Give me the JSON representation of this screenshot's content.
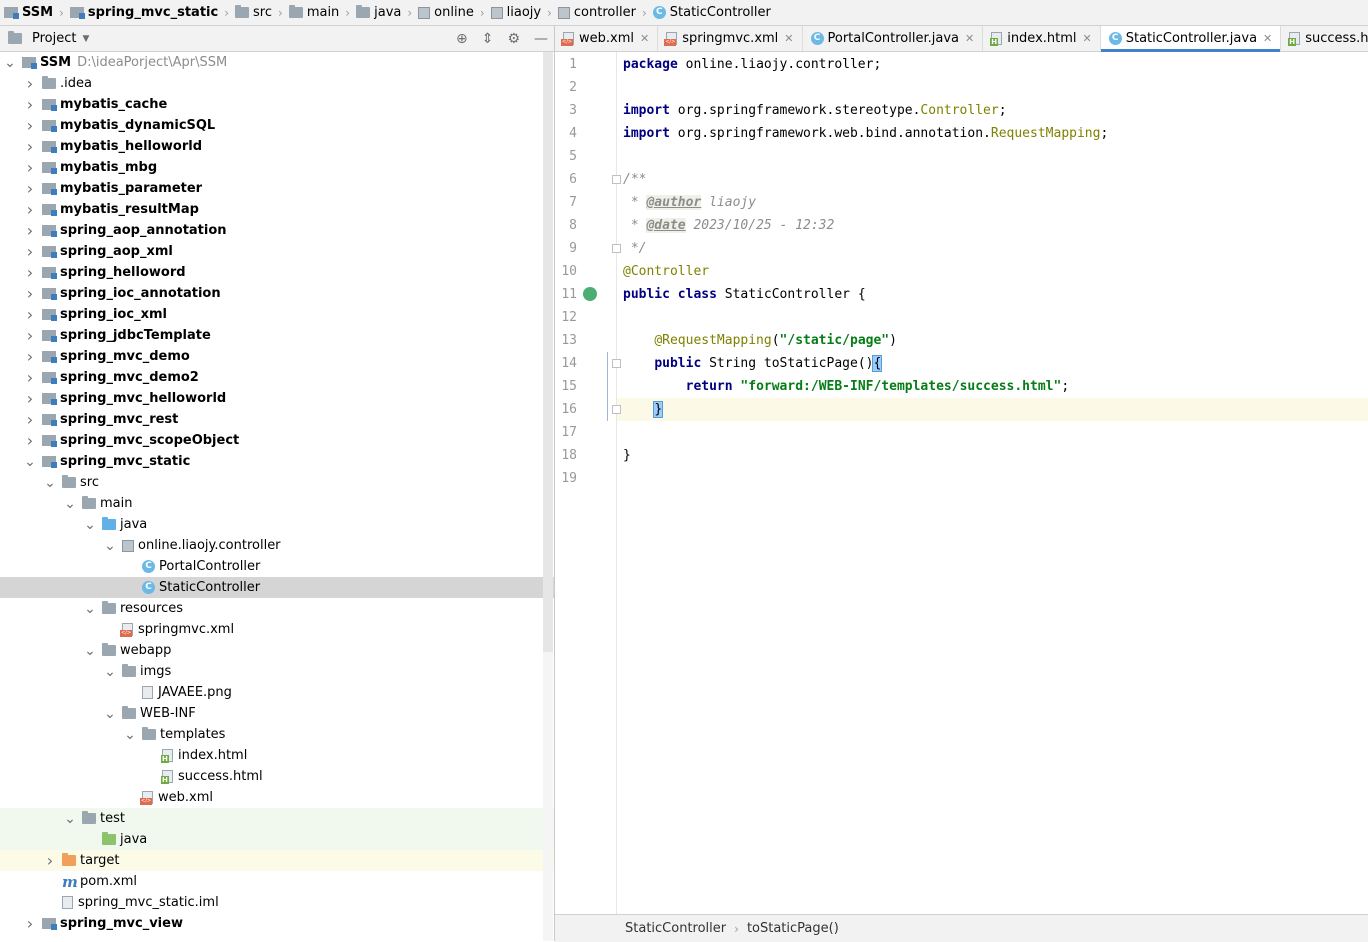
{
  "breadcrumb": [
    {
      "label": "SSM",
      "icon": "module-icon",
      "bold": true
    },
    {
      "label": "spring_mvc_static",
      "icon": "module-icon",
      "bold": true
    },
    {
      "label": "src",
      "icon": "folder-icon"
    },
    {
      "label": "main",
      "icon": "folder-icon"
    },
    {
      "label": "java",
      "icon": "folder-icon"
    },
    {
      "label": "online",
      "icon": "package-icon"
    },
    {
      "label": "liaojy",
      "icon": "package-icon"
    },
    {
      "label": "controller",
      "icon": "package-icon"
    },
    {
      "label": "StaticController",
      "icon": "class-icon"
    }
  ],
  "project_panel": {
    "title": "Project",
    "tree": [
      {
        "label": "SSM",
        "path": "D:\\ideaPorject\\Apr\\SSM",
        "depth": 0,
        "arrow": "down",
        "icon": "module",
        "bold": true
      },
      {
        "label": ".idea",
        "depth": 1,
        "arrow": "right",
        "icon": "folder"
      },
      {
        "label": "mybatis_cache",
        "depth": 1,
        "arrow": "right",
        "icon": "module",
        "bold": true
      },
      {
        "label": "mybatis_dynamicSQL",
        "depth": 1,
        "arrow": "right",
        "icon": "module",
        "bold": true
      },
      {
        "label": "mybatis_helloworld",
        "depth": 1,
        "arrow": "right",
        "icon": "module",
        "bold": true
      },
      {
        "label": "mybatis_mbg",
        "depth": 1,
        "arrow": "right",
        "icon": "module",
        "bold": true
      },
      {
        "label": "mybatis_parameter",
        "depth": 1,
        "arrow": "right",
        "icon": "module",
        "bold": true
      },
      {
        "label": "mybatis_resultMap",
        "depth": 1,
        "arrow": "right",
        "icon": "module",
        "bold": true
      },
      {
        "label": "spring_aop_annotation",
        "depth": 1,
        "arrow": "right",
        "icon": "module",
        "bold": true
      },
      {
        "label": "spring_aop_xml",
        "depth": 1,
        "arrow": "right",
        "icon": "module",
        "bold": true
      },
      {
        "label": "spring_helloword",
        "depth": 1,
        "arrow": "right",
        "icon": "module",
        "bold": true
      },
      {
        "label": "spring_ioc_annotation",
        "depth": 1,
        "arrow": "right",
        "icon": "module",
        "bold": true
      },
      {
        "label": "spring_ioc_xml",
        "depth": 1,
        "arrow": "right",
        "icon": "module",
        "bold": true
      },
      {
        "label": "spring_jdbcTemplate",
        "depth": 1,
        "arrow": "right",
        "icon": "module",
        "bold": true
      },
      {
        "label": "spring_mvc_demo",
        "depth": 1,
        "arrow": "right",
        "icon": "module",
        "bold": true
      },
      {
        "label": "spring_mvc_demo2",
        "depth": 1,
        "arrow": "right",
        "icon": "module",
        "bold": true
      },
      {
        "label": "spring_mvc_helloworld",
        "depth": 1,
        "arrow": "right",
        "icon": "module",
        "bold": true
      },
      {
        "label": "spring_mvc_rest",
        "depth": 1,
        "arrow": "right",
        "icon": "module",
        "bold": true
      },
      {
        "label": "spring_mvc_scopeObject",
        "depth": 1,
        "arrow": "right",
        "icon": "module",
        "bold": true
      },
      {
        "label": "spring_mvc_static",
        "depth": 1,
        "arrow": "down",
        "icon": "module",
        "bold": true
      },
      {
        "label": "src",
        "depth": 2,
        "arrow": "down",
        "icon": "folder"
      },
      {
        "label": "main",
        "depth": 3,
        "arrow": "down",
        "icon": "folder"
      },
      {
        "label": "java",
        "depth": 4,
        "arrow": "down",
        "icon": "folder-blue"
      },
      {
        "label": "online.liaojy.controller",
        "depth": 5,
        "arrow": "down",
        "icon": "package"
      },
      {
        "label": "PortalController",
        "depth": 6,
        "arrow": "none",
        "icon": "class"
      },
      {
        "label": "StaticController",
        "depth": 6,
        "arrow": "none",
        "icon": "class",
        "selected": true
      },
      {
        "label": "resources",
        "depth": 4,
        "arrow": "down",
        "icon": "folder"
      },
      {
        "label": "springmvc.xml",
        "depth": 5,
        "arrow": "none",
        "icon": "xml"
      },
      {
        "label": "webapp",
        "depth": 4,
        "arrow": "down",
        "icon": "folder"
      },
      {
        "label": "imgs",
        "depth": 5,
        "arrow": "down",
        "icon": "folder"
      },
      {
        "label": "JAVAEE.png",
        "depth": 6,
        "arrow": "none",
        "icon": "file"
      },
      {
        "label": "WEB-INF",
        "depth": 5,
        "arrow": "down",
        "icon": "folder"
      },
      {
        "label": "templates",
        "depth": 6,
        "arrow": "down",
        "icon": "folder"
      },
      {
        "label": "index.html",
        "depth": 7,
        "arrow": "none",
        "icon": "html"
      },
      {
        "label": "success.html",
        "depth": 7,
        "arrow": "none",
        "icon": "html"
      },
      {
        "label": "web.xml",
        "depth": 6,
        "arrow": "none",
        "icon": "xml"
      },
      {
        "label": "test",
        "depth": 3,
        "arrow": "down",
        "icon": "folder",
        "hl": true
      },
      {
        "label": "java",
        "depth": 4,
        "arrow": "none",
        "icon": "folder-green",
        "hl": true
      },
      {
        "label": "target",
        "depth": 2,
        "arrow": "right",
        "icon": "folder-orange",
        "yl": true
      },
      {
        "label": "pom.xml",
        "depth": 2,
        "arrow": "none",
        "icon": "maven"
      },
      {
        "label": "spring_mvc_static.iml",
        "depth": 2,
        "arrow": "none",
        "icon": "file"
      },
      {
        "label": "spring_mvc_view",
        "depth": 1,
        "arrow": "right",
        "icon": "module",
        "bold": true
      }
    ]
  },
  "tabs": [
    {
      "label": "web.xml",
      "icon": "xml"
    },
    {
      "label": "springmvc.xml",
      "icon": "xml"
    },
    {
      "label": "PortalController.java",
      "icon": "class"
    },
    {
      "label": "index.html",
      "icon": "html"
    },
    {
      "label": "StaticController.java",
      "icon": "class",
      "active": true
    },
    {
      "label": "success.html",
      "icon": "html"
    }
  ],
  "editor": {
    "line_numbers": [
      "1",
      "2",
      "3",
      "4",
      "5",
      "6",
      "7",
      "8",
      "9",
      "10",
      "11",
      "12",
      "13",
      "14",
      "15",
      "16",
      "17",
      "18",
      "19"
    ],
    "current_line": 16,
    "lines": [
      [
        {
          "t": "package",
          "c": "kw"
        },
        {
          "t": " online.liaojy.controller;"
        }
      ],
      [],
      [
        {
          "t": "import",
          "c": "kw"
        },
        {
          "t": " org.springframework.stereotype."
        },
        {
          "t": "Controller",
          "c": "ann"
        },
        {
          "t": ";"
        }
      ],
      [
        {
          "t": "import",
          "c": "kw"
        },
        {
          "t": " org.springframework.web.bind.annotation."
        },
        {
          "t": "RequestMapping",
          "c": "ann"
        },
        {
          "t": ";"
        }
      ],
      [],
      [
        {
          "t": "/**",
          "c": "cmt"
        }
      ],
      [
        {
          "t": " * ",
          "c": "cmt"
        },
        {
          "t": "@author",
          "c": "tag"
        },
        {
          "t": " liaojy",
          "c": "cmt"
        }
      ],
      [
        {
          "t": " * ",
          "c": "cmt"
        },
        {
          "t": "@date",
          "c": "tag"
        },
        {
          "t": " 2023/10/25 - 12:32",
          "c": "cmt"
        }
      ],
      [
        {
          "t": " */",
          "c": "cmt"
        }
      ],
      [
        {
          "t": "@Controller",
          "c": "ann"
        }
      ],
      [
        {
          "t": "public",
          "c": "kw"
        },
        {
          "t": " "
        },
        {
          "t": "class",
          "c": "kw"
        },
        {
          "t": " StaticController {"
        }
      ],
      [],
      [
        {
          "t": "    "
        },
        {
          "t": "@RequestMapping",
          "c": "ann"
        },
        {
          "t": "("
        },
        {
          "t": "\"/static/page\"",
          "c": "str"
        },
        {
          "t": ")"
        }
      ],
      [
        {
          "t": "    "
        },
        {
          "t": "public",
          "c": "kw"
        },
        {
          "t": " String toStaticPage()"
        },
        {
          "t": "{",
          "c": "brace"
        }
      ],
      [
        {
          "t": "        "
        },
        {
          "t": "return",
          "c": "kw"
        },
        {
          "t": " "
        },
        {
          "t": "\"forward:/WEB-INF/templates/success.html\"",
          "c": "str"
        },
        {
          "t": ";"
        }
      ],
      [
        {
          "t": "    "
        },
        {
          "t": "}",
          "c": "brace"
        }
      ],
      [],
      [
        {
          "t": "}"
        }
      ],
      []
    ]
  },
  "statusbar": {
    "class_name": "StaticController",
    "method_name": "toStaticPage()"
  }
}
